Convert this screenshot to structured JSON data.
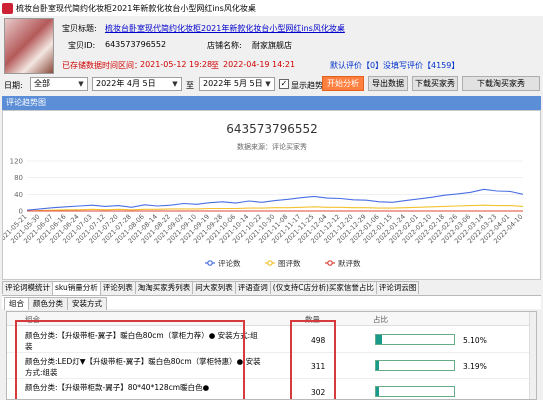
{
  "window": {
    "title": "梳妆台卧室现代简约化妆柜2021年新款化妆台小型网红ins风化妆桌"
  },
  "product": {
    "title_label": "宝贝标题:",
    "title_value": "梳妆台卧室现代简约化妆柜2021年新款化妆台小型网红ins风化妆桌",
    "id_label": "宝贝ID:",
    "id_value": "643573796552",
    "shop_label": "店铺名称:",
    "shop_value": "耐家旗舰店",
    "range_prefix": "已存储数据时间区间：",
    "range_start": "2021-05-12 19:28",
    "range_to": "至",
    "range_end": "2022-04-19 14:21",
    "default_review_label": "默认评价【0】",
    "no_review_label": "没填写评价【4159】"
  },
  "filter": {
    "date_label": "日期:",
    "scope_value": "全部",
    "start_date": "2022年 4月 5日",
    "end_date": "2022年 5月 5日",
    "to_label": "至",
    "show_trend_label": "显示趋势图",
    "show_trend_checked": true,
    "analyze_button": "开始分析",
    "export_button": "导出数据",
    "download_buyer_button": "下载买家秀",
    "download_tao_button": "下载淘买家秀"
  },
  "panel": {
    "heading": "评论趋势图"
  },
  "chart_data": {
    "type": "line",
    "title": "643573796552",
    "subtitle": "数据来源：评论买家秀",
    "ylim": [
      0,
      120
    ],
    "y_ticks": [
      "0",
      "40",
      "80",
      "120"
    ],
    "x": [
      "2021-05-21",
      "2021-05-30",
      "2021-06-07",
      "2021-06-16",
      "2021-06-24",
      "2021-07-03",
      "2021-07-12",
      "2021-07-20",
      "2021-07-28",
      "2021-08-06",
      "2021-08-14",
      "2021-08-22",
      "2021-09-02",
      "2021-09-10",
      "2021-09-19",
      "2021-09-28",
      "2021-10-06",
      "2021-10-14",
      "2021-10-22",
      "2021-10-30",
      "2021-11-08",
      "2021-11-17",
      "2021-11-25",
      "2021-12-04",
      "2021-12-12",
      "2021-12-20",
      "2021-12-29",
      "2022-01-06",
      "2022-01-15",
      "2022-01-24",
      "2022-02-01",
      "2022-02-10",
      "2022-02-18",
      "2022-02-26",
      "2022-03-06",
      "2022-03-14",
      "2022-03-23",
      "2022-04-01",
      "2022-04-10"
    ],
    "series": [
      {
        "name": "评论数",
        "color": "#4a6fe3",
        "values": [
          2,
          5,
          8,
          10,
          12,
          14,
          11,
          13,
          9,
          15,
          12,
          14,
          18,
          16,
          20,
          22,
          19,
          24,
          21,
          25,
          28,
          32,
          35,
          31,
          30,
          27,
          26,
          22,
          21,
          25,
          29,
          33,
          38,
          41,
          45,
          52,
          48,
          47,
          40
        ]
      },
      {
        "name": "图评数",
        "color": "#f2c230",
        "values": [
          0,
          1,
          2,
          3,
          3,
          4,
          3,
          4,
          3,
          4,
          4,
          5,
          5,
          5,
          6,
          6,
          6,
          7,
          7,
          8,
          8,
          9,
          10,
          9,
          9,
          8,
          8,
          7,
          7,
          8,
          9,
          10,
          11,
          12,
          13,
          14,
          13,
          13,
          11
        ]
      },
      {
        "name": "默评数",
        "color": "#e0443a",
        "values": [
          0,
          0,
          0,
          0,
          0,
          0,
          0,
          0,
          0,
          0,
          0,
          0,
          0,
          0,
          0,
          0,
          0,
          0,
          0,
          0,
          0,
          0,
          0,
          0,
          0,
          0,
          0,
          0,
          0,
          0,
          0,
          0,
          0,
          0,
          0,
          0,
          0,
          0,
          0
        ]
      }
    ]
  },
  "tabs": [
    "评论词模统计",
    "sku销量分析",
    "评论列表",
    "淘淘买家秀列表",
    "问大家列表",
    "评语查词",
    "(仅支持C店分析)买家信誉占比",
    "评论词云图"
  ],
  "active_tab": 1,
  "subtabs": [
    "组合",
    "颜色分类",
    "安装方式"
  ],
  "grid": {
    "headers": {
      "combo": "组合",
      "count": "数量",
      "ratio": "占比"
    },
    "rows": [
      {
        "name": "颜色分类:【升级带柜-翼子】暖白色80cm（掌柜力荐）● 安装方式:组装",
        "count": "498",
        "pct": "5.10%",
        "ratio": 0.051
      },
      {
        "name": "颜色分类:LED灯▼【升级带柜-翼子】暖白色80cm（掌柜特惠）● 安装方式:组装",
        "count": "311",
        "pct": "3.19%",
        "ratio": 0.0319
      },
      {
        "name": "颜色分类:【升级带柜款-翼子】80*40*128cm暖白色●",
        "count": "302",
        "pct": "",
        "ratio": 0.03
      }
    ]
  }
}
